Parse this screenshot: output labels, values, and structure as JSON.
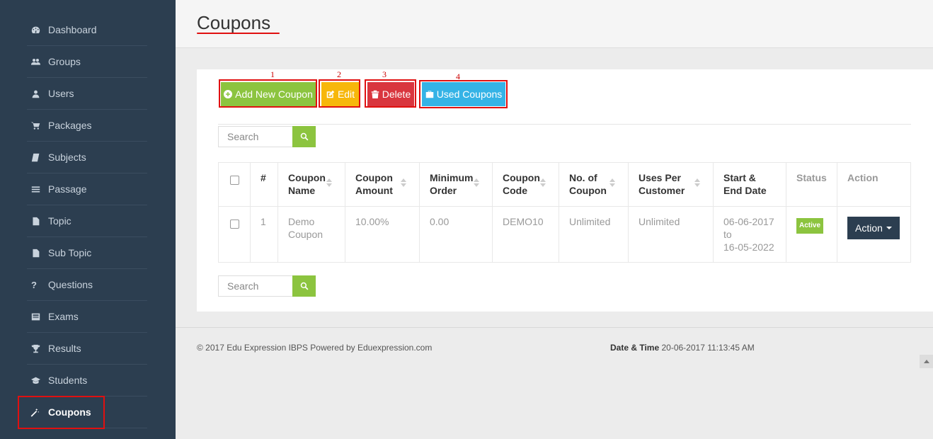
{
  "sidebar": {
    "items": [
      {
        "label": "Dashboard",
        "icon": "dashboard-icon"
      },
      {
        "label": "Groups",
        "icon": "groups-icon"
      },
      {
        "label": "Users",
        "icon": "user-icon"
      },
      {
        "label": "Packages",
        "icon": "cart-icon"
      },
      {
        "label": "Subjects",
        "icon": "book-icon"
      },
      {
        "label": "Passage",
        "icon": "list-icon"
      },
      {
        "label": "Topic",
        "icon": "file-icon"
      },
      {
        "label": "Sub Topic",
        "icon": "file-icon"
      },
      {
        "label": "Questions",
        "icon": "question-icon"
      },
      {
        "label": "Exams",
        "icon": "list-alt-icon"
      },
      {
        "label": "Results",
        "icon": "trophy-icon"
      },
      {
        "label": "Students",
        "icon": "graduation-cap-icon"
      },
      {
        "label": "Coupons",
        "icon": "magic-wand-icon",
        "active": true
      }
    ]
  },
  "header": {
    "title": "Coupons"
  },
  "toolbar": {
    "add_label": "Add New Coupon",
    "edit_label": "Edit",
    "delete_label": "Delete",
    "used_label": "Used Coupons",
    "markers": [
      "1",
      "2",
      "3",
      "4"
    ]
  },
  "search": {
    "placeholder": "Search"
  },
  "table": {
    "headers": {
      "num": "#",
      "name": "Coupon Name",
      "amount": "Coupon Amount",
      "min_order": "Minimum Order",
      "code": "Coupon Code",
      "no_coupon": "No. of Coupon",
      "uses": "Uses Per Customer",
      "dates": "Start & End Date",
      "status": "Status",
      "action": "Action"
    },
    "rows": [
      {
        "num": "1",
        "name": "Demo Coupon",
        "amount": "10.00%",
        "min_order": "0.00",
        "code": "DEMO10",
        "no_coupon": "Unlimited",
        "uses": "Unlimited",
        "start": "06-06-2017",
        "to": "to",
        "end": "16-05-2022",
        "status": "Active",
        "action": "Action"
      }
    ]
  },
  "footer": {
    "copyright": "© 2017 Edu Expression IBPS Powered by Eduexpression.com",
    "datetime_label": "Date & Time",
    "datetime_value": "20-06-2017 11:13:45 AM"
  },
  "colors": {
    "sidebar_bg": "#2c3e50",
    "green": "#8cc43f",
    "yellow": "#f7b70b",
    "red": "#d9363e",
    "blue": "#35b3e6",
    "annotation_red": "#e01010"
  }
}
